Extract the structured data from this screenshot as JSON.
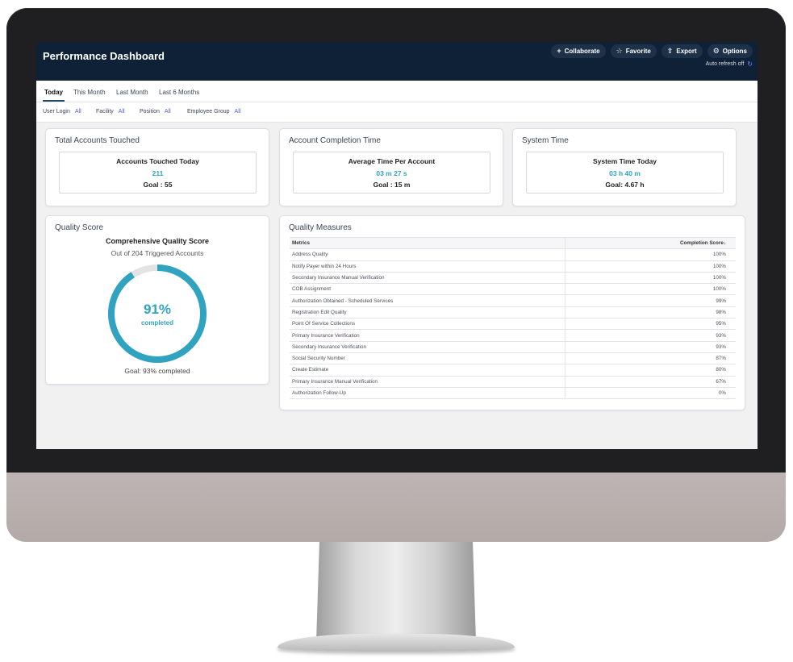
{
  "header": {
    "title": "Performance Dashboard",
    "buttons": [
      {
        "label": "Collaborate",
        "icon": "plus-icon"
      },
      {
        "label": "Favorite",
        "icon": "star-icon"
      },
      {
        "label": "Export",
        "icon": "export-icon"
      },
      {
        "label": "Options",
        "icon": "gear-icon"
      }
    ],
    "auto_refresh": "Auto refresh off"
  },
  "tabs": [
    "Today",
    "This Month",
    "Last Month",
    "Last 6 Months"
  ],
  "active_tab": "Today",
  "filters": [
    {
      "label": "User Login",
      "value": "All"
    },
    {
      "label": "Facility",
      "value": "All"
    },
    {
      "label": "Position",
      "value": "All"
    },
    {
      "label": "Employee Group",
      "value": "All"
    }
  ],
  "cards": {
    "accounts": {
      "title": "Total Accounts Touched",
      "label": "Accounts Touched Today",
      "value": "211",
      "goal": "Goal : 55"
    },
    "completion": {
      "title": "Account Completion Time",
      "label": "Average Time Per Account",
      "value": "03 m 27 s",
      "goal": "Goal : 15 m"
    },
    "system": {
      "title": "System Time",
      "label": "System Time Today",
      "value": "03 h 40 m",
      "goal": "Goal: 4.67 h"
    }
  },
  "quality_score": {
    "title": "Quality Score",
    "heading": "Comprehensive Quality Score",
    "subheading": "Out of 204 Triggered Accounts",
    "percent_label": "91%",
    "percent_value": 0.91,
    "completed_label": "completed",
    "goal": "Goal: 93% completed"
  },
  "quality_measures": {
    "title": "Quality Measures",
    "columns": [
      "Metrics",
      "Completion Score"
    ],
    "rows": [
      [
        "Address Quality",
        "100%"
      ],
      [
        "Notify Payer within 24 Hours",
        "100%"
      ],
      [
        "Secondary Insurance Manual Verification",
        "100%"
      ],
      [
        "COB Assignment",
        "100%"
      ],
      [
        "Authorization Obtained - Scheduled Services",
        "99%"
      ],
      [
        "Registration Edit Quality",
        "98%"
      ],
      [
        "Point Of Service Collections",
        "95%"
      ],
      [
        "Primary Insurance Verification",
        "93%"
      ],
      [
        "Secondary Insurance Verification",
        "93%"
      ],
      [
        "Social Security Number",
        "87%"
      ],
      [
        "Create Estimate",
        "80%"
      ],
      [
        "Primary Insurance Manual Verification",
        "67%"
      ],
      [
        "Authorization Follow-Up",
        "0%"
      ]
    ]
  },
  "colors": {
    "header_bg": "#0f2136",
    "accent": "#2fa3c0",
    "donut_track": "#e3e3e5",
    "filter_value": "#4a5fc4"
  }
}
